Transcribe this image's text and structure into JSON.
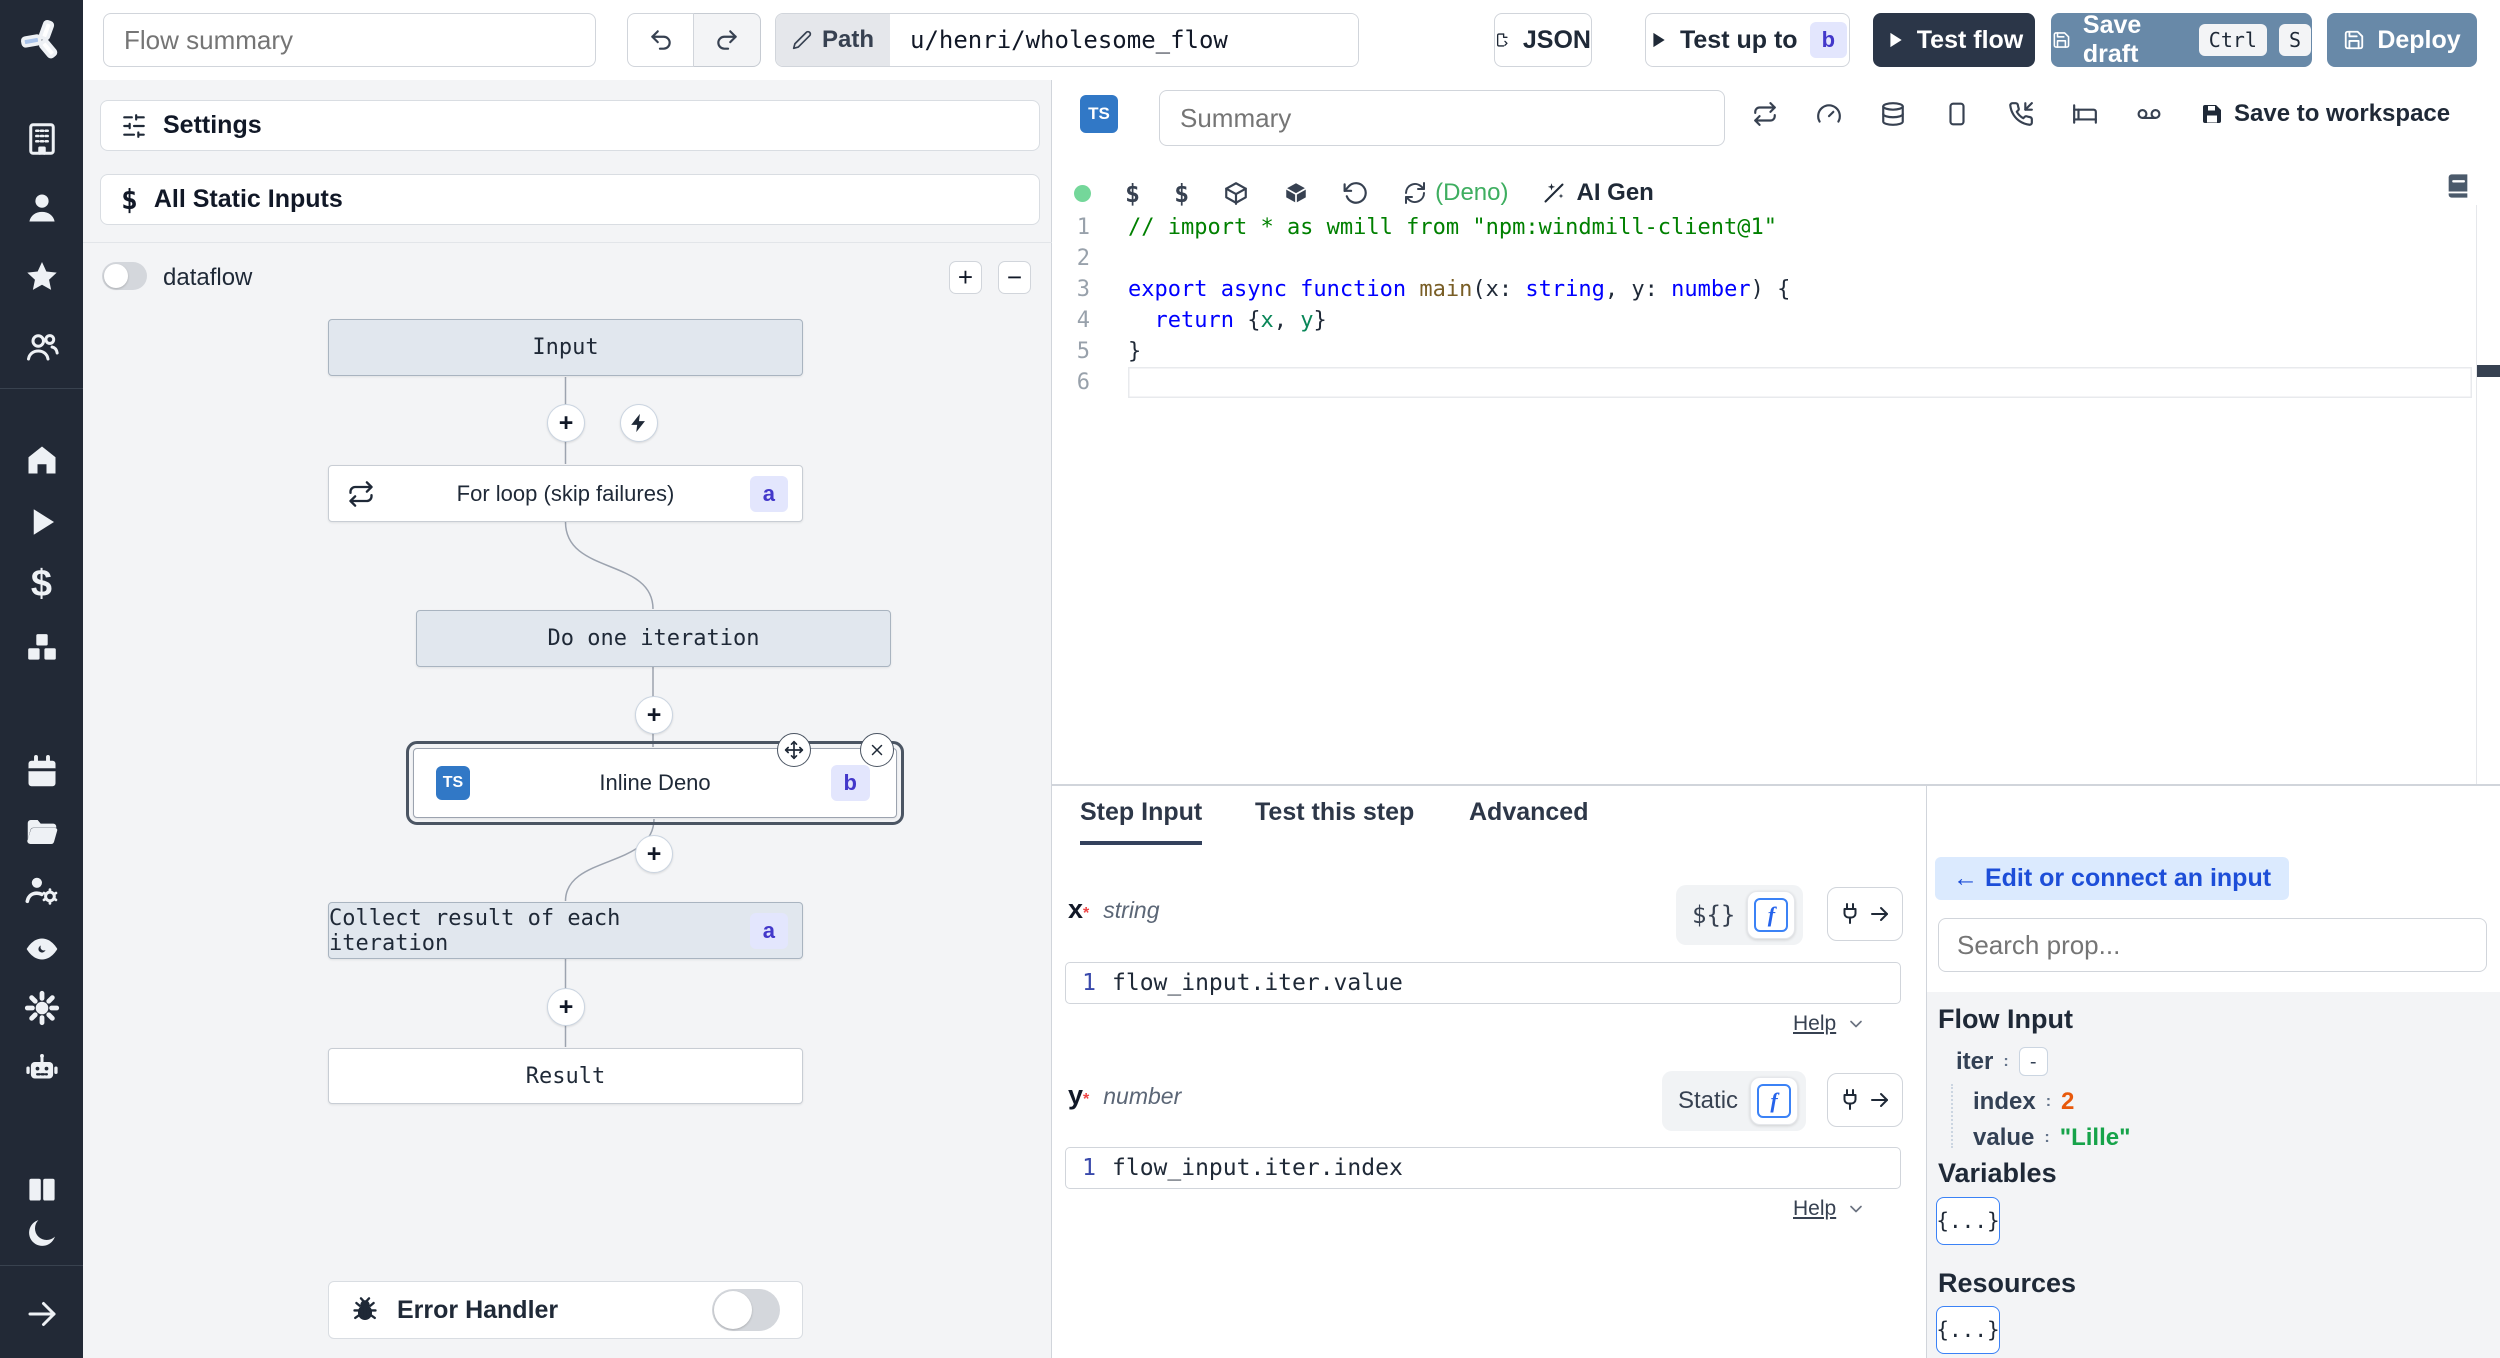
{
  "header": {
    "flow_summary_placeholder": "Flow summary",
    "path_label": "Path",
    "path_value": "u/henri/wholesome_flow",
    "json_button": "JSON",
    "test_up_to_label": "Test up to",
    "test_up_to_badge": "b",
    "test_flow_label": "Test flow",
    "save_draft_label": "Save draft",
    "save_draft_kbd_1": "Ctrl",
    "save_draft_kbd_2": "S",
    "deploy_label": "Deploy"
  },
  "sidebar": {
    "icons": [
      "building",
      "user",
      "star",
      "users",
      "home",
      "play",
      "dollar",
      "boxes",
      "calendar",
      "folder",
      "users-gear",
      "eye",
      "gear",
      "robot",
      "books",
      "moon",
      "arrow-right"
    ]
  },
  "flow_panel": {
    "settings_label": "Settings",
    "static_inputs_label": "All Static Inputs",
    "dataflow_label": "dataflow",
    "zoom_in_label": "+",
    "zoom_out_label": "−",
    "error_handler_label": "Error Handler",
    "nodes": [
      {
        "label": "Input"
      },
      {
        "label": "For loop (skip failures)",
        "badge": "a"
      },
      {
        "label": "Do one iteration"
      },
      {
        "label": "Inline Deno",
        "badge": "b",
        "lang": "TS"
      },
      {
        "label": "Collect result of each iteration",
        "badge": "a"
      },
      {
        "label": "Result"
      }
    ]
  },
  "editor": {
    "lang_badge": "TS",
    "summary_placeholder": "Summary",
    "dollar_1": "$",
    "dollar_2": "$",
    "deno_label": "(Deno)",
    "ai_gen_label": "AI Gen",
    "save_to_workspace_label": "Save to workspace",
    "code_lines": [
      {
        "n": "1",
        "tokens": [
          [
            "// import * as wmill from \"npm:windmill-client@1\"",
            "comment"
          ]
        ]
      },
      {
        "n": "2",
        "tokens": []
      },
      {
        "n": "3",
        "tokens": [
          [
            "export async function ",
            "kw"
          ],
          [
            "main",
            "fn"
          ],
          [
            "(x: ",
            "plain"
          ],
          [
            "string",
            "type"
          ],
          [
            ", y: ",
            "plain"
          ],
          [
            "number",
            "type"
          ],
          [
            ") {",
            "plain"
          ]
        ]
      },
      {
        "n": "4",
        "tokens": [
          [
            "  ",
            "plain"
          ],
          [
            "return",
            "kw"
          ],
          [
            " {",
            "plain"
          ],
          [
            "x",
            "prop"
          ],
          [
            ", ",
            "plain"
          ],
          [
            "y",
            "prop"
          ],
          [
            "}",
            "plain"
          ]
        ]
      },
      {
        "n": "5",
        "tokens": [
          [
            "}",
            "plain"
          ]
        ]
      },
      {
        "n": "6",
        "tokens": [],
        "current": true
      }
    ]
  },
  "step_panel": {
    "tabs": [
      {
        "label": "Step Input"
      },
      {
        "label": "Test this step"
      },
      {
        "label": "Advanced"
      }
    ],
    "fields": [
      {
        "name": "x",
        "required": "*",
        "type": "string",
        "mode": "${}",
        "code": "flow_input.iter.value",
        "line": "1",
        "help": "Help"
      },
      {
        "name": "y",
        "required": "*",
        "type": "number",
        "mode": "Static",
        "code": "flow_input.iter.index",
        "line": "1",
        "help": "Help"
      }
    ]
  },
  "prop_panel": {
    "edit_connect_label": "← Edit or connect an input",
    "search_placeholder": "Search prop...",
    "flow_input_title": "Flow Input",
    "tree": {
      "iter_key": "iter",
      "iter_colon": ":",
      "iter_collapse": "-",
      "index_key": "index",
      "index_colon": ":",
      "index_value": "2",
      "value_key": "value",
      "value_colon": ":",
      "value_value": "\"Lille\""
    },
    "variables_title": "Variables",
    "variables_button": "{...}",
    "resources_title": "Resources",
    "resources_button": "{...}"
  },
  "colors": {
    "sidebar_bg": "#222936",
    "steel_button": "#6889a8",
    "dark_button": "#2b3648",
    "badge_bg": "#e3e6fd",
    "badge_text": "#4338ca",
    "deno_green": "#3eae60",
    "index_orange": "#e8590c",
    "string_green": "#16a34a",
    "ts_blue": "#3178c6"
  }
}
